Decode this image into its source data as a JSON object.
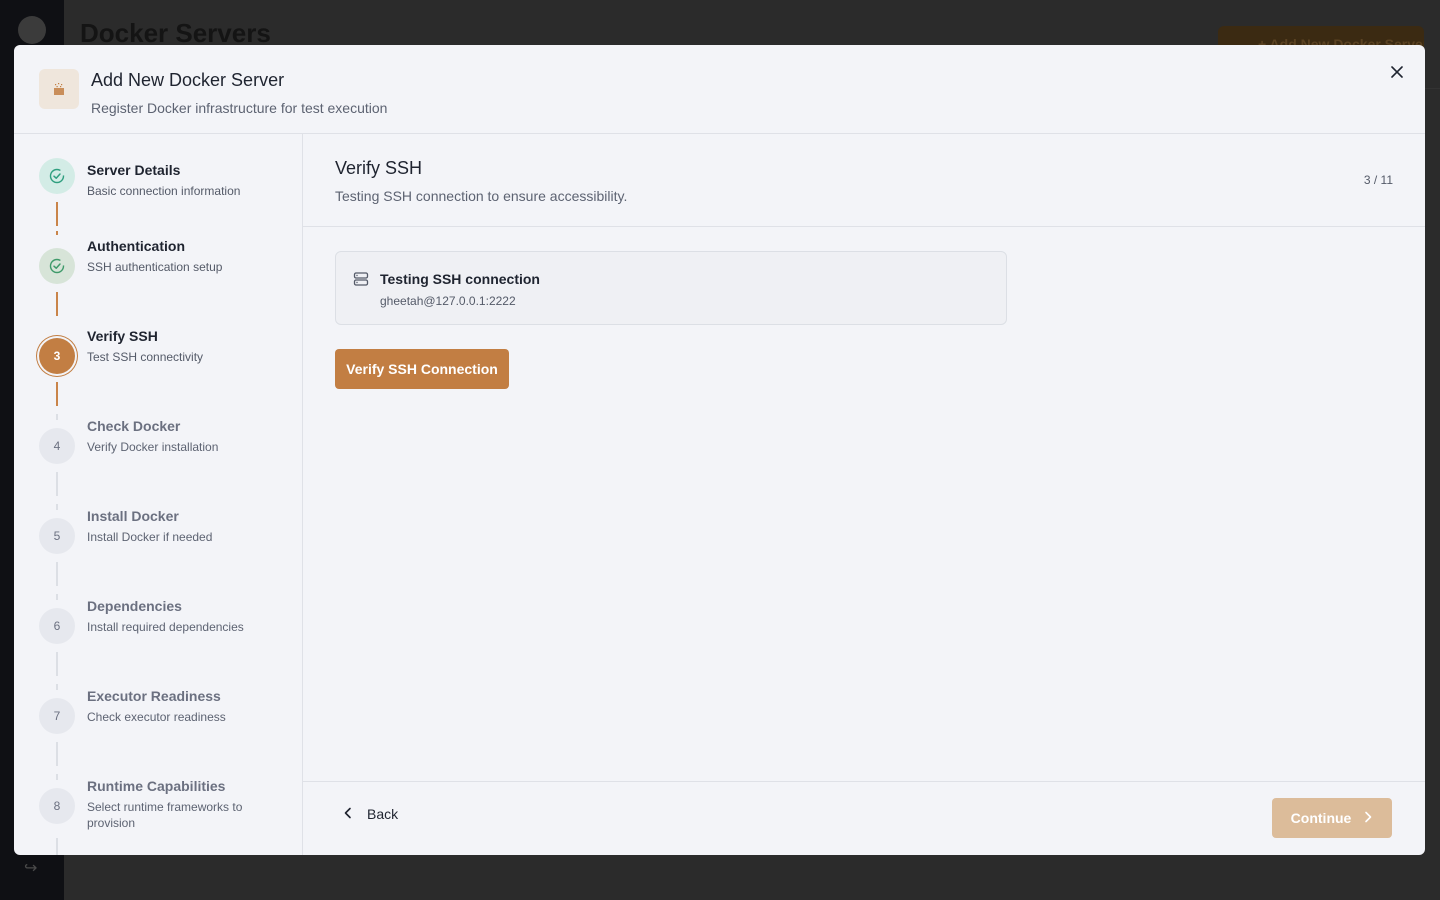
{
  "background": {
    "page_title": "Docker Servers",
    "add_button_label": "+ Add New Docker Server"
  },
  "modal": {
    "title": "Add New Docker Server",
    "subtitle": "Register Docker infrastructure for test execution",
    "icon": "docker-server-icon",
    "close_icon": "close-icon"
  },
  "stepper": {
    "steps": [
      {
        "number": "1",
        "title": "Server Details",
        "desc": "Basic connection information",
        "status": "completed"
      },
      {
        "number": "2",
        "title": "Authentication",
        "desc": "SSH authentication setup",
        "status": "completed"
      },
      {
        "number": "3",
        "title": "Verify SSH",
        "desc": "Test SSH connectivity",
        "status": "current"
      },
      {
        "number": "4",
        "title": "Check Docker",
        "desc": "Verify Docker installation",
        "status": "pending"
      },
      {
        "number": "5",
        "title": "Install Docker",
        "desc": "Install Docker if needed",
        "status": "pending"
      },
      {
        "number": "6",
        "title": "Dependencies",
        "desc": "Install required dependencies",
        "status": "pending"
      },
      {
        "number": "7",
        "title": "Executor Readiness",
        "desc": "Check executor readiness",
        "status": "pending"
      },
      {
        "number": "8",
        "title": "Runtime Capabilities",
        "desc": "Select runtime frameworks to provision",
        "status": "pending"
      }
    ]
  },
  "content": {
    "title": "Verify SSH",
    "subtitle": "Testing SSH connection to ensure accessibility.",
    "step_counter": "3 / 11",
    "connection": {
      "title": "Testing SSH connection",
      "target": "gheetah@127.0.0.1:2222",
      "icon": "server-icon"
    },
    "verify_button": "Verify SSH Connection"
  },
  "footer": {
    "back_label": "Back",
    "continue_label": "Continue"
  },
  "colors": {
    "accent": "#c27e43",
    "accent_disabled": "#dcbc9a",
    "completed_bg": "#d3ece6",
    "completed_check": "#2f9f7f"
  }
}
